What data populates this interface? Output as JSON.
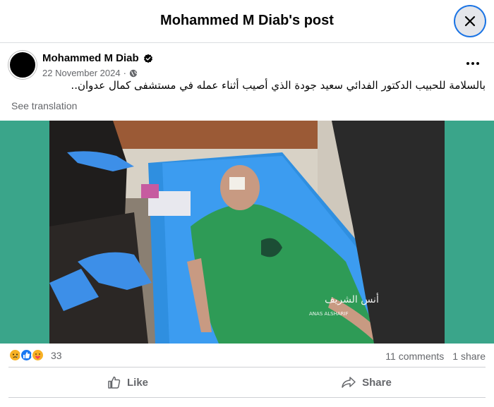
{
  "dialog": {
    "title": "Mohammed M Diab's post"
  },
  "post": {
    "author": "Mohammed M Diab",
    "date": "22 November 2024",
    "separator": "·",
    "text": "بالسلامة للحبيب الدكتور الفدائي سعيد جودة الذي أصيب أثناء عمله في مستشفى كمال عدوان..",
    "see_translation": "See translation",
    "watermark_icons": [
      "verified-icon",
      "globe-icon",
      "more-icon"
    ]
  },
  "media": {
    "background_color": "#3aa58a",
    "watermark_text": "ANAS ALSHARIF"
  },
  "engagement": {
    "reaction_icons": [
      "sad-react-icon",
      "like-react-icon",
      "care-react-icon"
    ],
    "reaction_count": "33",
    "comments": "11 comments",
    "shares": "1 share"
  },
  "actions": {
    "like": "Like",
    "share": "Share"
  },
  "colors": {
    "accent": "#1b74e4",
    "secondary_text": "#65676b"
  }
}
